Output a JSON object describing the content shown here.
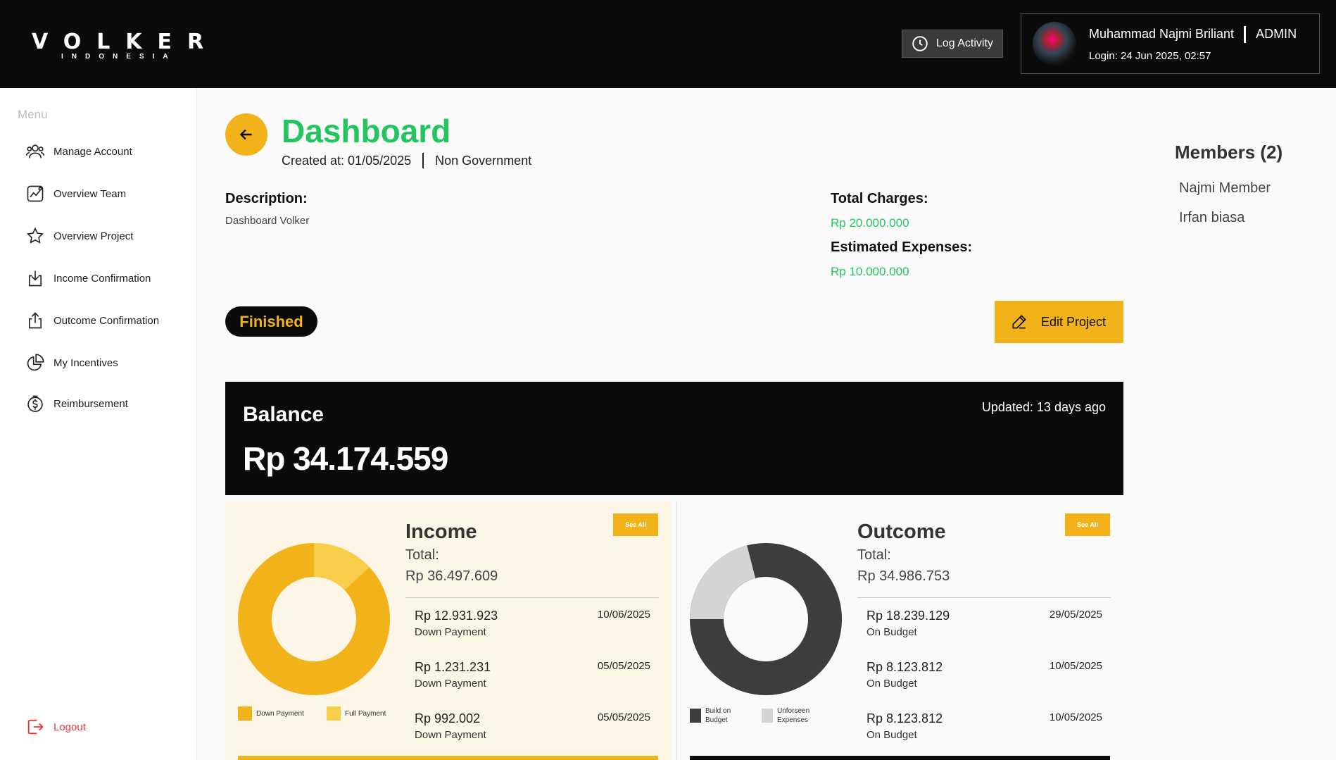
{
  "header": {
    "logo_word": "VOLKER",
    "logo_sub": "INDONESIA",
    "log_activity_label": "Log Activity",
    "user_name": "Muhammad Najmi Briliant",
    "user_role": "ADMIN",
    "login_info": "Login: 24 Jun 2025, 02:57"
  },
  "sidebar": {
    "menu_title": "Menu",
    "items": [
      {
        "label": "Manage Account",
        "icon": "users-icon"
      },
      {
        "label": "Overview Team",
        "icon": "chart-line-icon"
      },
      {
        "label": "Overview Project",
        "icon": "star-icon"
      },
      {
        "label": "Income Confirmation",
        "icon": "download-icon"
      },
      {
        "label": "Outcome Confirmation",
        "icon": "upload-icon"
      },
      {
        "label": "My Incentives",
        "icon": "pie-chart-icon"
      },
      {
        "label": "Reimbursement",
        "icon": "dollar-circle-icon"
      }
    ],
    "logout_label": "Logout"
  },
  "project": {
    "title": "Dashboard",
    "created_at": "Created at: 01/05/2025",
    "type": "Non Government",
    "description_label": "Description:",
    "description": "Dashboard Volker",
    "total_charges_label": "Total Charges:",
    "total_charges": "Rp 20.000.000",
    "estimated_expenses_label": "Estimated Expenses:",
    "estimated_expenses": "Rp 10.000.000",
    "status": "Finished",
    "edit_label": "Edit Project"
  },
  "members": {
    "title": "Members (2)",
    "list": [
      "Najmi Member",
      "Irfan biasa"
    ]
  },
  "balance": {
    "label": "Balance",
    "value": "Rp 34.174.559",
    "updated": "Updated: 13 days ago"
  },
  "income": {
    "title": "Income",
    "total_label": "Total:",
    "total": "Rp 36.497.609",
    "see_all": "See All",
    "transactions": [
      {
        "amount": "Rp 12.931.923",
        "type": "Down Payment",
        "date": "10/06/2025"
      },
      {
        "amount": "Rp 1.231.231",
        "type": "Down Payment",
        "date": "05/05/2025"
      },
      {
        "amount": "Rp 992.002",
        "type": "Down Payment",
        "date": "05/05/2025"
      }
    ],
    "legend": [
      "Down Payment",
      "Full Payment"
    ],
    "chart": {
      "down_payment_fraction": 0.87,
      "full_payment_fraction": 0.13
    }
  },
  "outcome": {
    "title": "Outcome",
    "total_label": "Total:",
    "total": "Rp 34.986.753",
    "see_all": "See All",
    "transactions": [
      {
        "amount": "Rp 18.239.129",
        "type": "On Budget",
        "date": "29/05/2025"
      },
      {
        "amount": "Rp 8.123.812",
        "type": "On Budget",
        "date": "10/05/2025"
      },
      {
        "amount": "Rp 8.123.812",
        "type": "On Budget",
        "date": "10/05/2025"
      }
    ],
    "legend": [
      "Build on Budget",
      "Unforseen Expenses"
    ],
    "chart": {
      "build_on_budget_fraction": 0.79,
      "unforseen_fraction": 0.21
    }
  },
  "colors": {
    "accent": "#f2b31a",
    "accent_light": "#f7cd4a",
    "green": "#22c55e",
    "dark": "#0b0b0b",
    "outcome_dark": "#3d3d3d",
    "outcome_light": "#d4d4d4",
    "logout": "#e53935"
  }
}
